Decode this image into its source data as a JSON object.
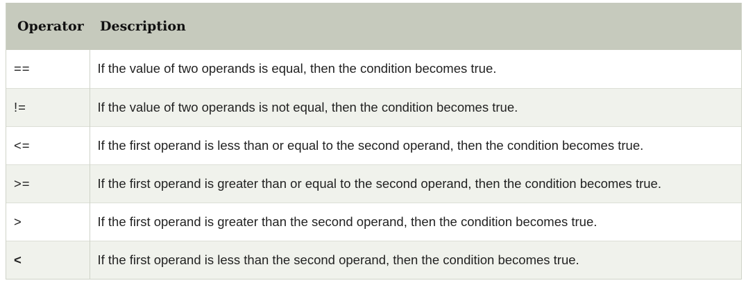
{
  "table": {
    "headers": {
      "operator": "Operator",
      "description": "Description"
    },
    "rows": [
      {
        "operator": "==",
        "description": "If the value of two operands is equal, then the condition becomes true."
      },
      {
        "operator": "!=",
        "description": "If the value of two operands is not equal, then the condition becomes true."
      },
      {
        "operator": "<=",
        "description": "If the first operand is less than or equal to the second operand, then the condition becomes true."
      },
      {
        "operator": ">=",
        "description": "If the first operand is greater than or equal to the second operand, then the condition becomes true."
      },
      {
        "operator": ">",
        "description": "If the first operand is greater than the second operand, then the condition becomes true."
      },
      {
        "operator": "<",
        "description": "If the first operand is less than the second operand, then the condition becomes true."
      }
    ]
  },
  "colors": {
    "header_bg": "#c6cabd",
    "row_alt_bg": "#f0f2ec",
    "border": "#cfd3c8"
  }
}
